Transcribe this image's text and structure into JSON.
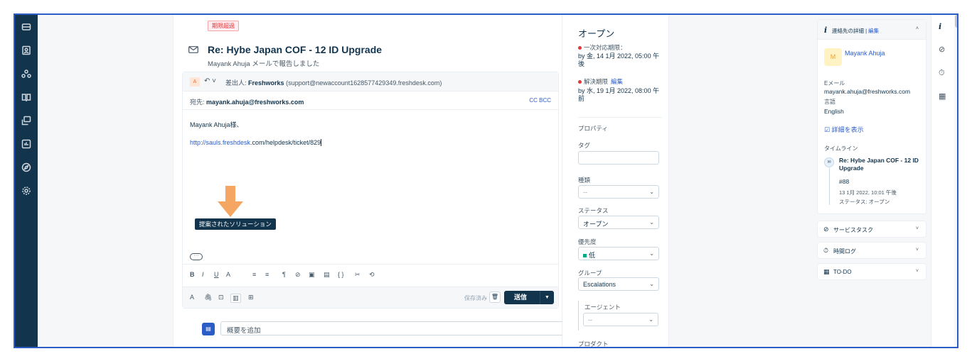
{
  "nav": {
    "icons": [
      "inbox-icon",
      "contacts-icon",
      "groups-icon",
      "book-icon",
      "copy-icon",
      "reports-icon",
      "compass-icon",
      "settings-icon"
    ]
  },
  "ticket": {
    "overdue_badge": "期限超過",
    "subject": "Re: Hybe Japan COF - 12 ID Upgrade",
    "reported_by": "Mayank Ahuja メールで報告しました",
    "from_label": "差出人:",
    "from_name": "Freshworks",
    "from_email": "(support@newaccount1628577429349.freshdesk.com)",
    "to_label": "宛先:",
    "to_email": "mayank.ahuja@freshworks.com",
    "cc_bcc": "CC  BCC",
    "greeting": "Mayank Ahuja様、",
    "link_host": "http://sauls.freshdesk",
    "link_path": ".com/helpdesk/ticket/829",
    "tooltip": "提案されたソリューション",
    "saved": "保存済み",
    "send": "送信",
    "summary_placeholder": "概要を追加",
    "avatar_letter": "A",
    "toolbar": [
      "B",
      "I",
      "U",
      "A",
      "≡",
      "≡",
      "¶",
      "⊘",
      "▣",
      "▤",
      "{ }",
      "✂",
      "⟲"
    ],
    "bottom_tools": [
      "A",
      "🖇",
      "⊡",
      "▥",
      "⊞"
    ]
  },
  "properties": {
    "status_title": "オープン",
    "first_response_label": "一次対応期限：",
    "first_response_value": "by 金, 14 1月 2022, 05:00 午後",
    "resolution_label": "解決期限",
    "resolution_edit": "編集",
    "resolution_value": "by 水, 19 1月 2022, 08:00 午前",
    "section_title": "プロパティ",
    "tag_label": "タグ",
    "type_label": "種類",
    "type_value": "--",
    "status_label": "ステータス",
    "status_value": "オープン",
    "priority_label": "優先度",
    "priority_value": "低",
    "group_label": "グループ",
    "group_value": "Escalations",
    "agent_label": "エージェント",
    "agent_value": "--",
    "product_label": "プロダクト"
  },
  "contact": {
    "header": "連絡先の詳細",
    "header_sep": " | ",
    "header_edit": "編集",
    "avatar_letter": "M",
    "name": "Mayank Ahuja",
    "email_label": "Eメール",
    "email_value": "mayank.ahuja@freshworks.com",
    "language_label": "言語",
    "language_value": "English",
    "details_link": "詳細を表示",
    "timeline_label": "タイムライン",
    "timeline_subject": "Re: Hybe Japan COF - 12 ID Upgrade",
    "timeline_number": "#88",
    "timeline_date": "13 1月 2022, 10:01 午後",
    "timeline_status": "ステータス: オープン"
  },
  "accordions": [
    {
      "label": "サービスタスク",
      "icon": "⊘"
    },
    {
      "label": "時間ログ",
      "icon": "⏱"
    },
    {
      "label": "TO-DO",
      "icon": "▦"
    }
  ],
  "colors": {
    "nav_bg": "#12344d",
    "accent": "#2c5cc5",
    "arrow": "#f5a662",
    "overdue": "#e43538",
    "priority_low": "#00a886"
  }
}
